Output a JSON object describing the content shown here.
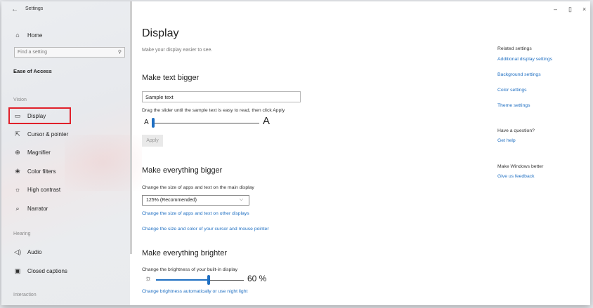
{
  "window": {
    "title": "Settings",
    "controls": {
      "minimize": "–",
      "maximize": "▯",
      "close": "×"
    }
  },
  "sidebar": {
    "home_label": "Home",
    "search_placeholder": "Find a setting",
    "category_title": "Ease of Access",
    "groups": {
      "vision": "Vision",
      "hearing": "Hearing",
      "interaction": "Interaction"
    },
    "vision_items": [
      {
        "label": "Display",
        "icon": "monitor-icon",
        "selected": true
      },
      {
        "label": "Cursor & pointer",
        "icon": "cursor-icon"
      },
      {
        "label": "Magnifier",
        "icon": "magnifier-icon"
      },
      {
        "label": "Color filters",
        "icon": "color-filter-icon"
      },
      {
        "label": "High contrast",
        "icon": "high-contrast-icon"
      },
      {
        "label": "Narrator",
        "icon": "narrator-icon"
      }
    ],
    "hearing_items": [
      {
        "label": "Audio",
        "icon": "audio-icon"
      },
      {
        "label": "Closed captions",
        "icon": "captions-icon"
      }
    ]
  },
  "main": {
    "title": "Display",
    "subtitle": "Make your display easier to see.",
    "text_bigger": {
      "heading": "Make text bigger",
      "sample_text": "Sample text",
      "instruction": "Drag the slider until the sample text is easy to read, then click Apply",
      "small_a": "A",
      "large_a": "A",
      "apply_label": "Apply",
      "slider_fraction": 0.0
    },
    "everything_bigger": {
      "heading": "Make everything bigger",
      "description": "Change the size of apps and text on the main display",
      "scale_value": "125% (Recommended)",
      "link_other_displays": "Change the size of apps and text on other displays",
      "link_cursor": "Change the size and color of your cursor and mouse pointer"
    },
    "everything_brighter": {
      "heading": "Make everything brighter",
      "description": "Change the brightness of your built-in display",
      "brightness_percent": 60,
      "brightness_label": "60 %",
      "link_night_light": "Change brightness automatically or use night light"
    }
  },
  "related": {
    "heading": "Related settings",
    "links": [
      "Additional display settings",
      "Background settings",
      "Color settings",
      "Theme settings"
    ],
    "question_heading": "Have a question?",
    "get_help": "Get help",
    "better_heading": "Make Windows better",
    "feedback": "Give us feedback"
  },
  "colors": {
    "accent": "#1f6fc2",
    "highlight_border": "#e0202a"
  }
}
